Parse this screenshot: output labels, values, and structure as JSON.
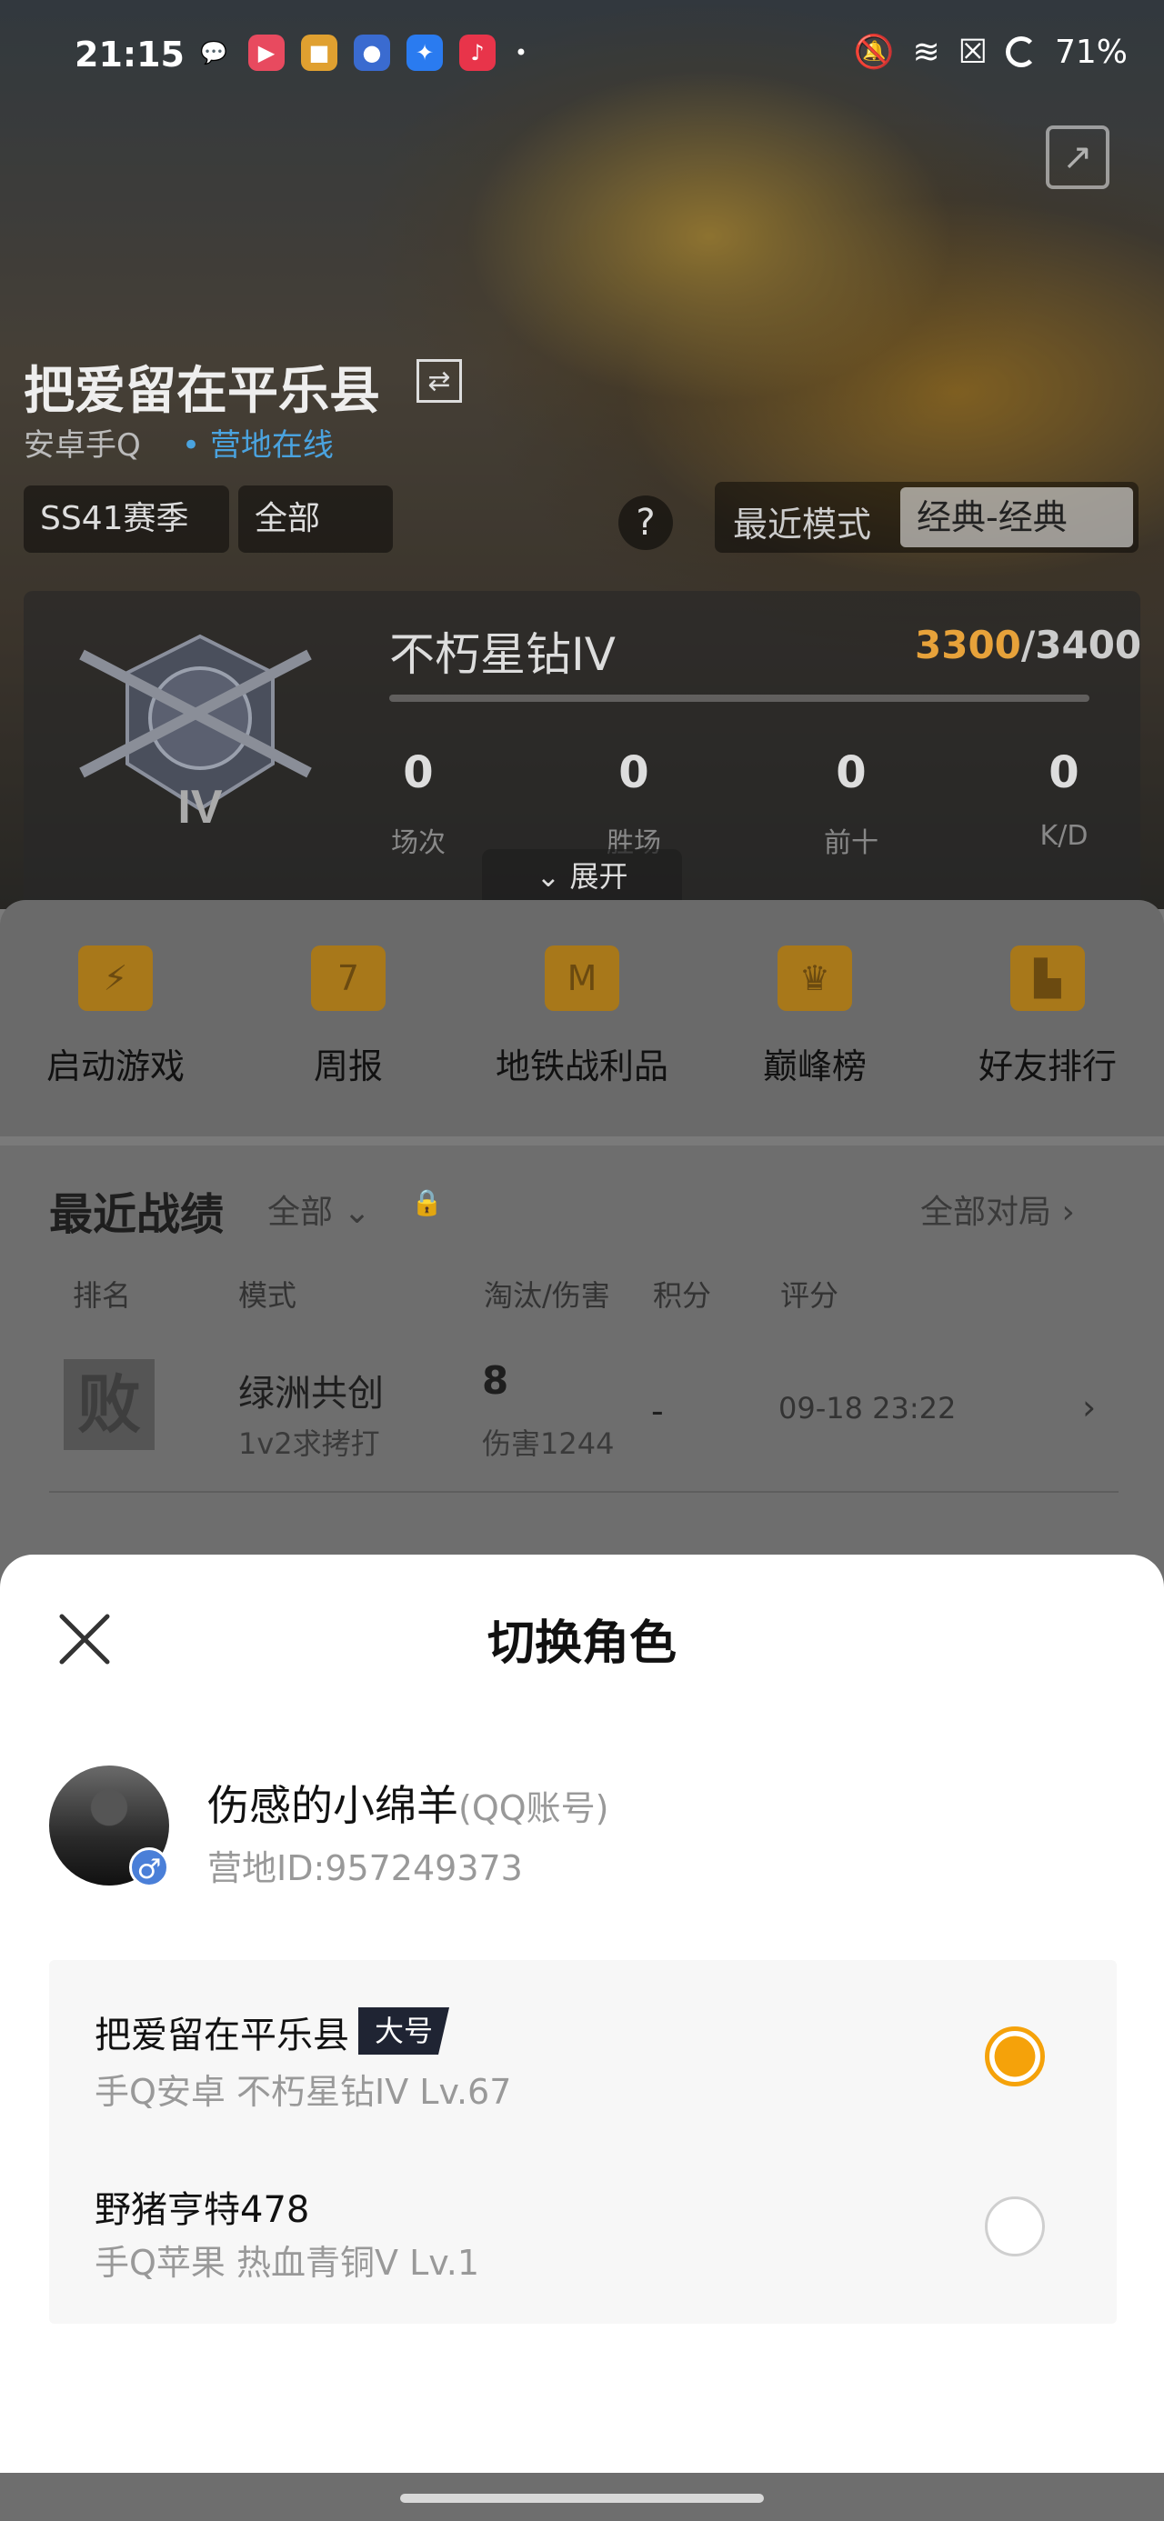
{
  "status_bar": {
    "time": "21:15",
    "battery": "71%",
    "icons": [
      "wechat-icon",
      "video-app-icon",
      "game-app-icon",
      "panda-app-icon",
      "star-app-icon",
      "music-app-icon",
      "dot-icon"
    ],
    "right_icons": [
      "mute-icon",
      "wifi-icon",
      "sim-icon",
      "battery-icon"
    ]
  },
  "profile": {
    "name": "把爱留在平乐县",
    "platform": "安卓手Q",
    "online_status": "• 营地在线",
    "season": "SS41赛季",
    "season_arrow": "⌄",
    "scope": "全部",
    "help": "?",
    "mode_label": "最近模式",
    "mode_value": "经典-经典",
    "tier": "不朽星钻IV",
    "tier_badge": "IV",
    "points_current": "3300",
    "points_max": "/3400",
    "stats": [
      {
        "value": "0",
        "label": "场次"
      },
      {
        "value": "0",
        "label": "胜场"
      },
      {
        "value": "0",
        "label": "前十"
      },
      {
        "value": "0",
        "label": "K/D"
      }
    ],
    "expand": "⌄ 展开"
  },
  "quick_actions": [
    {
      "label": "启动游戏",
      "icon": "lightning-icon"
    },
    {
      "label": "周报",
      "icon": "calendar-icon"
    },
    {
      "label": "地铁战利品",
      "icon": "metro-shield-icon"
    },
    {
      "label": "巅峰榜",
      "icon": "crown-shield-icon"
    },
    {
      "label": "好友排行",
      "icon": "podium-icon"
    }
  ],
  "records": {
    "title": "最近战绩",
    "filter": "全部 ⌄",
    "all_matches": "全部对局 ›",
    "headers": [
      "排名",
      "模式",
      "淘汰/伤害",
      "积分",
      "评分"
    ],
    "rows": [
      {
        "rank": "败",
        "mode": "绿洲共创",
        "sub": "1v2求拷打",
        "kills": "8",
        "damage": "伤害1244",
        "score": "-",
        "date": "09-18 23:22"
      }
    ]
  },
  "sheet": {
    "title": "切换角色",
    "account_name": "伤感的小绵羊",
    "account_type": "(QQ账号)",
    "account_id": "营地ID:957249373",
    "gender": "♂",
    "roles": [
      {
        "name": "把爱留在平乐县",
        "tag": "大号",
        "desc": "手Q安卓  不朽星钻IV  Lv.67",
        "selected": true
      },
      {
        "name": "野猪亨特478",
        "tag": "",
        "desc": "手Q苹果  热血青铜V  Lv.1",
        "selected": false
      }
    ]
  },
  "colors": {
    "accent": "#f5a20a",
    "online": "#4aa3df",
    "gender": "#4a7fd8"
  }
}
